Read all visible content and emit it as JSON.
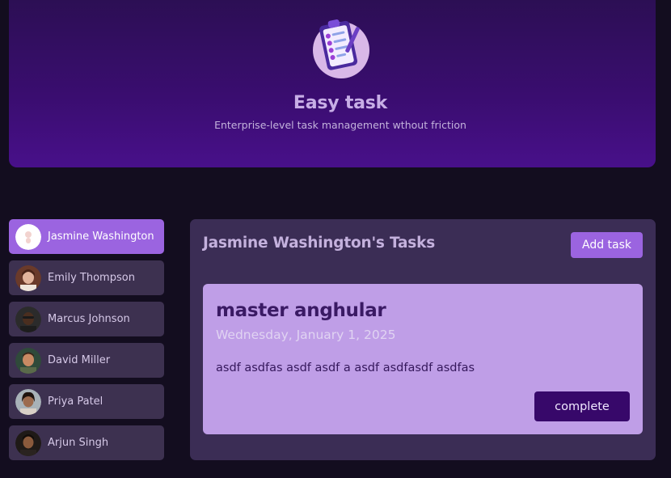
{
  "header": {
    "title": "Easy task",
    "subtitle": "Enterprise-level task management wthout friction",
    "logo_icon": "clipboard-checklist-icon"
  },
  "users": [
    {
      "name": "Jasmine Washington",
      "selected": true
    },
    {
      "name": "Emily Thompson",
      "selected": false
    },
    {
      "name": "Marcus Johnson",
      "selected": false
    },
    {
      "name": "David Miller",
      "selected": false
    },
    {
      "name": "Priya Patel",
      "selected": false
    },
    {
      "name": "Arjun Singh",
      "selected": false
    }
  ],
  "tasks_panel": {
    "title": "Jasmine Washington's Tasks",
    "add_task_label": "Add task",
    "tasks": [
      {
        "title": "master anghular",
        "due_date": "Wednesday, January 1, 2025",
        "summary": "asdf asdfas asdf asdf a asdf asdfasdf asdfas",
        "complete_label": "complete"
      }
    ]
  },
  "colors": {
    "background": "#130d1f",
    "header_gradient_top": "#2b0f52",
    "header_gradient_bottom": "#48108a",
    "accent": "#9b64e0",
    "panel": "#3b2d55",
    "card": "#bf9ee7",
    "complete_button": "#37086a"
  }
}
